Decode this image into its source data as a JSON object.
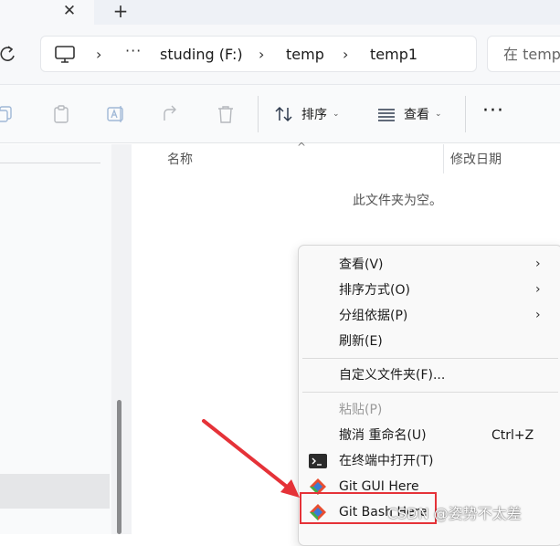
{
  "tabstrip": {
    "close_glyph": "✕",
    "new_tab_glyph": "+"
  },
  "address": {
    "more": "···",
    "crumbs": [
      "studing (F:)",
      "temp",
      "temp1"
    ],
    "sep": "›"
  },
  "search": {
    "placeholder_visible": "在 temp"
  },
  "commandbar": {
    "sort_label": "排序",
    "view_label": "查看",
    "caret": "⌄",
    "more": "···"
  },
  "filelist": {
    "col_name": "名称",
    "col_date": "修改日期",
    "sort_arrow": "^",
    "empty_message": "此文件夹为空。"
  },
  "context_menu": {
    "items": [
      {
        "label": "查看(V)",
        "submenu": true
      },
      {
        "label": "排序方式(O)",
        "submenu": true
      },
      {
        "label": "分组依据(P)",
        "submenu": true
      },
      {
        "label": "刷新(E)",
        "submenu": false
      },
      {
        "label": "自定义文件夹(F)...",
        "submenu": false
      },
      {
        "label": "粘贴(P)",
        "disabled": true
      },
      {
        "label": "撤消 重命名(U)",
        "shortcut": "Ctrl+Z"
      },
      {
        "label": "在终端中打开(T)",
        "icon": "terminal-icon"
      },
      {
        "label": "Git GUI Here",
        "icon": "git-icon"
      },
      {
        "label": "Git Bash Here",
        "icon": "git-icon"
      }
    ],
    "submenu_arrow": "›"
  },
  "watermark": "CSDN @姿势不太差",
  "colors": {
    "annotation_red": "#e53238",
    "git_red": "#e84e31",
    "git_blue": "#3a7bd5",
    "git_green": "#3fae49"
  }
}
